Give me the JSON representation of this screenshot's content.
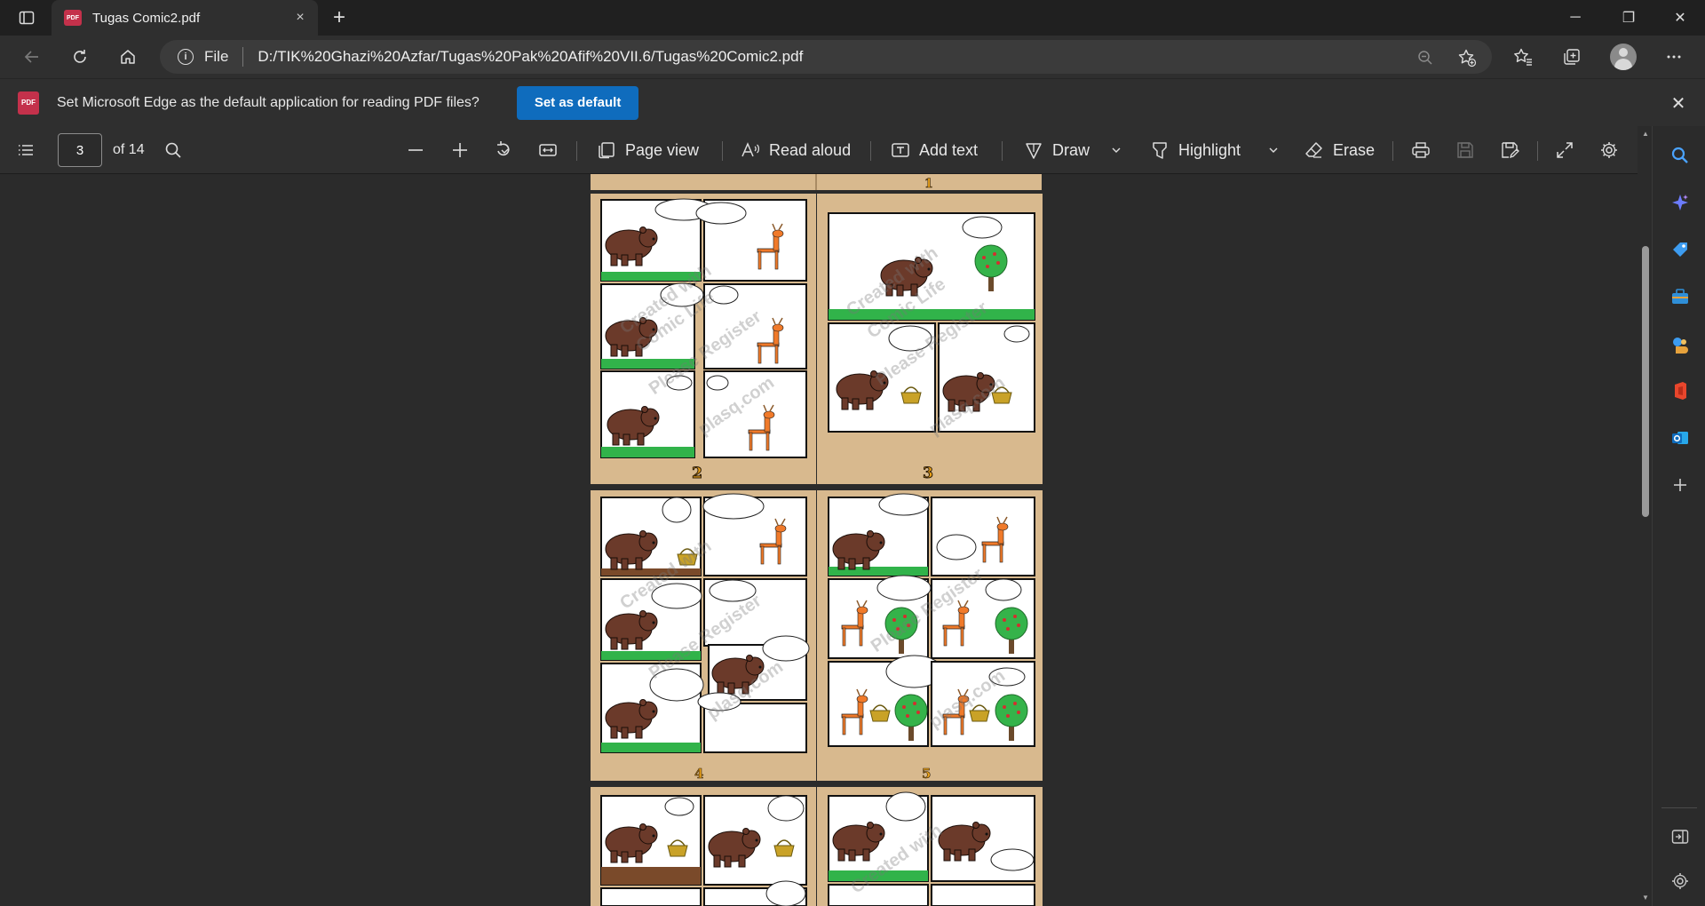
{
  "tab": {
    "badge": "PDF",
    "title": "Tugas Comic2.pdf",
    "close": "×",
    "new_tab": "+"
  },
  "window": {
    "minimize": "─",
    "restore": "❐",
    "close": "✕"
  },
  "address": {
    "info": "i",
    "scheme": "File",
    "url": "D:/TIK%20Ghazi%20Azfar/Tugas%20Pak%20Afif%20VII.6/Tugas%20Comic2.pdf"
  },
  "infobar": {
    "badge": "PDF",
    "message": "Set Microsoft Edge as the default application for reading PDF files?",
    "button": "Set as default",
    "close": "✕"
  },
  "pdf_toolbar": {
    "page_number": "3",
    "page_total": "of 14",
    "page_view": "Page view",
    "read_aloud": "Read aloud",
    "add_text": "Add text",
    "draw": "Draw",
    "highlight": "Highlight",
    "erase": "Erase"
  },
  "pages": [
    {
      "number": "2"
    },
    {
      "number": "3"
    },
    {
      "number": "4"
    },
    {
      "number": "5"
    }
  ],
  "watermark": {
    "line1": "Created with",
    "line2": "Comic Life",
    "line3": "Please Register",
    "line4": "plasq.com"
  },
  "colors": {
    "accent": "#0f6cbd",
    "pdf_red": "#c4314b",
    "page_bg": "#d8b98e",
    "grass": "#31b34a",
    "bear": "#6b3a2a",
    "deer": "#f07a2a"
  },
  "sidebar": [
    "search-icon",
    "copilot-icon",
    "shopping-tag-icon",
    "tools-icon",
    "games-icon",
    "office-icon",
    "outlook-icon",
    "add-icon",
    "hide-sidebar-icon",
    "sidebar-settings-icon"
  ]
}
